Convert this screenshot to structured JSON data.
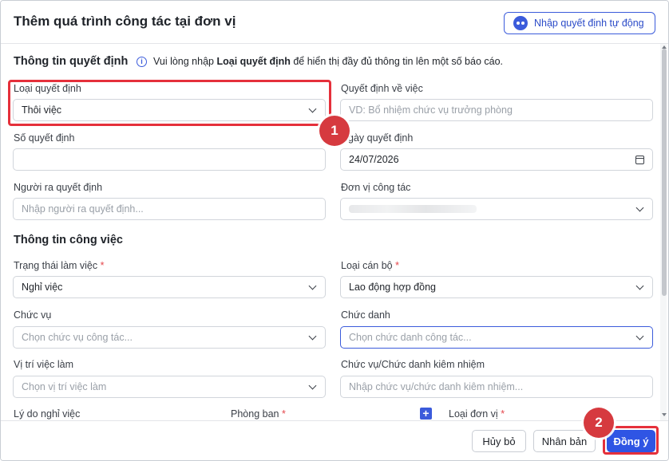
{
  "dialog": {
    "title": "Thêm quá trình công tác tại đơn vị",
    "auto_button": {
      "label": "Nhập quyết định tự động",
      "icon": "robot-icon"
    }
  },
  "decision_section": {
    "title": "Thông tin quyết định",
    "info_prefix": "Vui lòng nhập",
    "info_bold": "Loại quyết định",
    "info_suffix": "để hiển thị đầy đủ thông tin lên một số báo cáo.",
    "decision_type": {
      "label": "Loại quyết định",
      "value": "Thôi việc"
    },
    "decision_about": {
      "label": "Quyết định về việc",
      "placeholder": "VD: Bổ nhiệm chức vụ trưởng phòng"
    },
    "decision_number": {
      "label": "Số quyết định",
      "value": ""
    },
    "decision_date": {
      "label": "Ngày quyết định",
      "value": "24/07/2026"
    },
    "decision_maker": {
      "label": "Người ra quyết định",
      "placeholder": "Nhập người ra quyết định..."
    },
    "work_unit": {
      "label": "Đơn vị công tác",
      "value": ""
    }
  },
  "job_section": {
    "title": "Thông tin công việc",
    "work_status": {
      "label": "Trạng thái làm việc",
      "required": "*",
      "value": "Nghỉ việc"
    },
    "staff_type": {
      "label": "Loại cán bộ",
      "required": "*",
      "value": "Lao động hợp đồng"
    },
    "position": {
      "label": "Chức vụ",
      "placeholder": "Chọn chức vụ công tác..."
    },
    "title_field": {
      "label": "Chức danh",
      "placeholder": "Chọn chức danh công tác..."
    },
    "job_position": {
      "label": "Vị trí việc làm",
      "placeholder": "Chọn vị trí việc làm"
    },
    "concurrent": {
      "label": "Chức vụ/Chức danh kiêm nhiệm",
      "placeholder": "Nhập chức vụ/chức danh kiêm nhiệm..."
    },
    "resign_reason": {
      "label": "Lý do nghỉ việc"
    },
    "department": {
      "label": "Phòng ban",
      "required": "*"
    },
    "unit_type": {
      "label": "Loại đơn vị",
      "required": "*"
    }
  },
  "footer": {
    "cancel_label": "Hủy bỏ",
    "duplicate_label": "Nhân bản",
    "confirm_label": "Đồng ý"
  },
  "annotations": {
    "step1": "1",
    "step2": "2",
    "highlight_color": "#e5303b"
  }
}
